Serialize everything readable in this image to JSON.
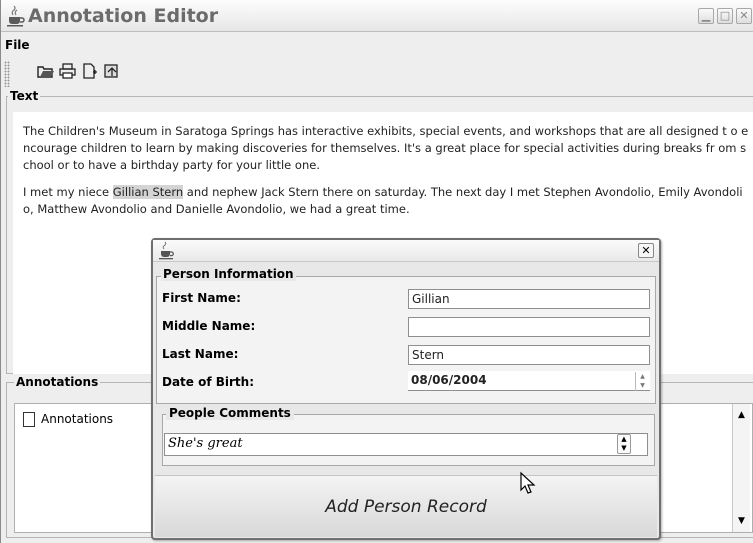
{
  "window": {
    "title": "Annotation Editor",
    "icon": "java-coffee-icon"
  },
  "menu": {
    "file": "File"
  },
  "toolbar": {
    "icons": [
      "open-folder-icon",
      "print-icon",
      "new-document-icon",
      "export-icon"
    ]
  },
  "text_panel": {
    "title": "Text",
    "para1": "The Children's Museum in Saratoga Springs has interactive exhibits, special events, and workshops that are all designed t o encourage children to learn by making discoveries for themselves.  It's a great place for special activities during breaks fr om school or to have a birthday party for your little one.",
    "para2_before": "I met my niece ",
    "para2_highlight": "Gillian Stern",
    "para2_after": " and nephew Jack Stern there on saturday. The next day I met Stephen Avondolio, Emily Avondoli o, Matthew Avondolio and Danielle Avondolio, we had a great time."
  },
  "annotations_panel": {
    "title": "Annotations",
    "tree_root": "Annotations"
  },
  "dialog": {
    "person_group_title": "Person Information",
    "first_name_label": "First Name:",
    "first_name_value": "Gillian",
    "middle_name_label": "Middle Name:",
    "middle_name_value": "",
    "last_name_label": "Last Name:",
    "last_name_value": "Stern",
    "dob_label": "Date of Birth:",
    "dob_value": "08/06/2004",
    "comments_title": "People Comments",
    "comments_value": "She's great",
    "add_button": "Add Person Record"
  }
}
